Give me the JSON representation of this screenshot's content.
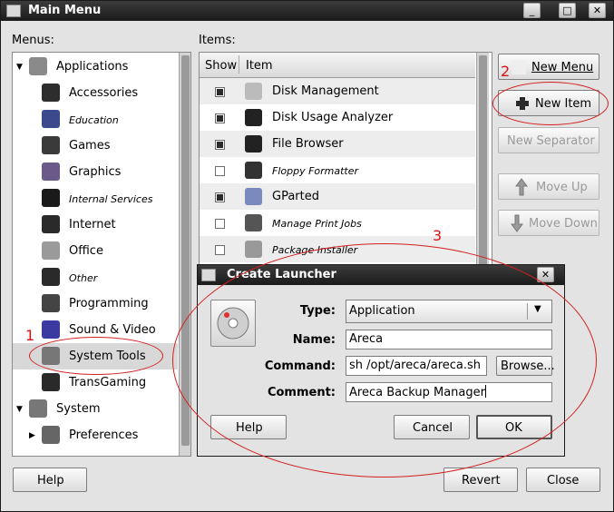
{
  "window": {
    "title": "Main Menu",
    "controls": [
      "_",
      "□",
      "✕"
    ]
  },
  "menus_label": "Menus:",
  "items_label": "Items:",
  "tree": [
    {
      "label": "Applications",
      "level": 0,
      "expanded": true,
      "icon": "applications-icon",
      "italic": false
    },
    {
      "label": "Accessories",
      "level": 1,
      "icon": "accessories-icon",
      "italic": false
    },
    {
      "label": "Education",
      "level": 1,
      "icon": "education-icon",
      "italic": true
    },
    {
      "label": "Games",
      "level": 1,
      "icon": "games-icon",
      "italic": false
    },
    {
      "label": "Graphics",
      "level": 1,
      "icon": "graphics-icon",
      "italic": false
    },
    {
      "label": "Internal Services",
      "level": 1,
      "icon": "internal-services-icon",
      "italic": true
    },
    {
      "label": "Internet",
      "level": 1,
      "icon": "internet-icon",
      "italic": false
    },
    {
      "label": "Office",
      "level": 1,
      "icon": "office-icon",
      "italic": false
    },
    {
      "label": "Other",
      "level": 1,
      "icon": "other-icon",
      "italic": true
    },
    {
      "label": "Programming",
      "level": 1,
      "icon": "programming-icon",
      "italic": false
    },
    {
      "label": "Sound & Video",
      "level": 1,
      "icon": "sound-video-icon",
      "italic": false
    },
    {
      "label": "System Tools",
      "level": 1,
      "icon": "system-tools-icon",
      "italic": false,
      "selected": true
    },
    {
      "label": "TransGaming",
      "level": 1,
      "icon": "transgaming-icon",
      "italic": false
    },
    {
      "label": "System",
      "level": 0,
      "expanded": true,
      "icon": "system-icon",
      "italic": false
    },
    {
      "label": "Preferences",
      "level": 1,
      "collapsed": true,
      "icon": "preferences-icon",
      "italic": false
    }
  ],
  "items_table": {
    "headers": [
      "Show",
      "Item"
    ],
    "rows": [
      {
        "checked": true,
        "label": "Disk Management",
        "italic": false,
        "icon": "disk-management-icon"
      },
      {
        "checked": true,
        "label": "Disk Usage Analyzer",
        "italic": false,
        "icon": "disk-usage-icon"
      },
      {
        "checked": true,
        "label": "File Browser",
        "italic": false,
        "icon": "file-browser-icon"
      },
      {
        "checked": false,
        "label": "Floppy Formatter",
        "italic": true,
        "icon": "floppy-icon"
      },
      {
        "checked": true,
        "label": "GParted",
        "italic": false,
        "icon": "gparted-icon"
      },
      {
        "checked": false,
        "label": "Manage Print Jobs",
        "italic": true,
        "icon": "print-jobs-icon"
      },
      {
        "checked": false,
        "label": "Package Installer",
        "italic": true,
        "icon": "package-installer-icon"
      }
    ]
  },
  "side_buttons": {
    "new_menu": "New Menu",
    "new_item": "New Item",
    "new_separator": "New Separator",
    "move_up": "Move Up",
    "move_down": "Move Down"
  },
  "bottom_buttons": {
    "help": "Help",
    "revert": "Revert",
    "close": "Close"
  },
  "annotations": [
    "1",
    "2",
    "3"
  ],
  "dialog": {
    "title": "Create Launcher",
    "type_label": "Type:",
    "type_value": "Application",
    "name_label": "Name:",
    "name_value": "Areca",
    "command_label": "Command:",
    "command_value": "sh /opt/areca/areca.sh",
    "browse_label": "Browse...",
    "comment_label": "Comment:",
    "comment_value": "Areca Backup Manager",
    "help": "Help",
    "cancel": "Cancel",
    "ok": "OK",
    "close": "✕"
  },
  "colors": {
    "annotation": "#d42020",
    "titlebar": "#2a2a2a"
  }
}
